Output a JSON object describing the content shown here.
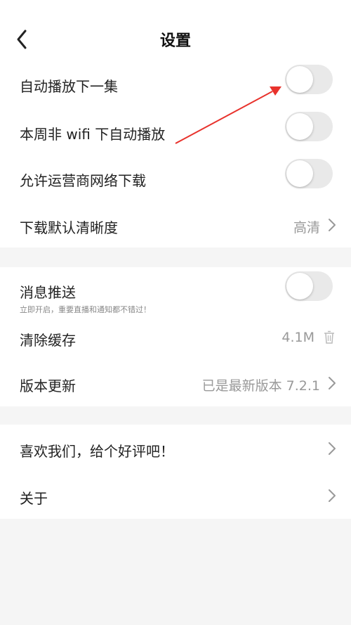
{
  "header": {
    "title": "设置"
  },
  "section1": {
    "autoplay_next": {
      "label": "自动播放下一集",
      "enabled": false
    },
    "weekly_non_wifi_autoplay": {
      "label": "本周非 wifi 下自动播放",
      "enabled": false
    },
    "allow_carrier_download": {
      "label": "允许运营商网络下载",
      "enabled": false
    },
    "download_quality": {
      "label": "下载默认清晰度",
      "value": "高清"
    }
  },
  "section2": {
    "push_notifications": {
      "label": "消息推送",
      "sublabel": "立即开启，重要直播和通知都不错过！",
      "enabled": false
    },
    "clear_cache": {
      "label": "清除缓存",
      "value": "4.1M"
    },
    "version_update": {
      "label": "版本更新",
      "value": "已是最新版本 7.2.1"
    }
  },
  "section3": {
    "rate_us": {
      "label": "喜欢我们，给个好评吧！"
    },
    "about": {
      "label": "关于"
    }
  },
  "colors": {
    "toggle_off": "#e9e9e9",
    "annotation_arrow": "#e8322c",
    "background": "#f5f5f5"
  }
}
